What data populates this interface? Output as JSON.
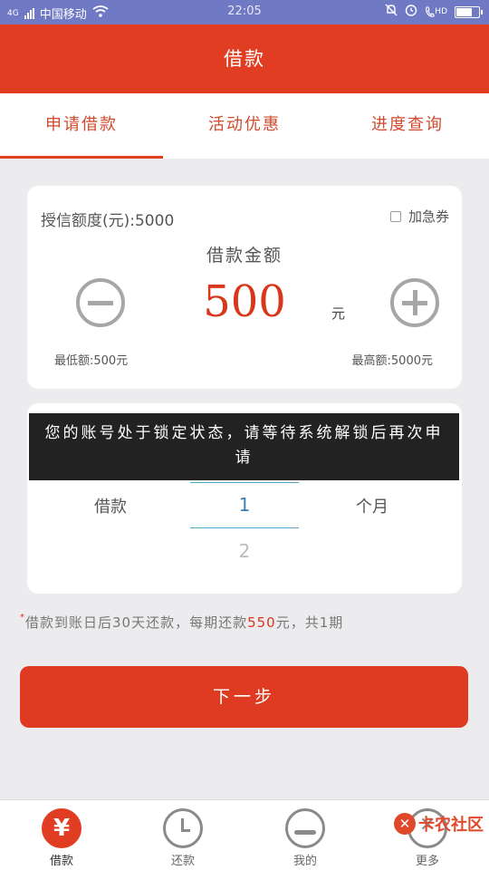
{
  "status_bar": {
    "network": "4G",
    "carrier": "中国移动",
    "time": "22:05",
    "hd": "HD",
    "battery_level": 0.7
  },
  "header": {
    "title": "借款"
  },
  "tabs": [
    {
      "label": "申请借款",
      "active": true
    },
    {
      "label": "活动优惠",
      "active": false
    },
    {
      "label": "进度查询",
      "active": false
    }
  ],
  "loan_card": {
    "credit_line": "授信额度(元):5000",
    "urgent_label": "加急券",
    "amount_title": "借款金额",
    "amount_value": "500",
    "unit": "元",
    "min_label": "最低额:500元",
    "max_label": "最高额:5000元"
  },
  "toast": {
    "message": "您的账号处于锁定状态，请等待系统解锁后再次申请"
  },
  "term_picker": {
    "label": "借款",
    "selected": "1",
    "next": "2",
    "unit": "个月"
  },
  "repay_note": {
    "star": "*",
    "prefix": "借款到账日后30天还款，每期还款",
    "amount": "550",
    "suffix": "元，共1期"
  },
  "next_button": {
    "label": "下一步"
  },
  "bottom_nav": [
    {
      "label": "借款",
      "icon": "yen-icon",
      "glyph": "¥",
      "active": true
    },
    {
      "label": "还款",
      "icon": "clock-icon",
      "active": false
    },
    {
      "label": "我的",
      "icon": "user-icon",
      "active": false
    },
    {
      "label": "更多",
      "icon": "more-icon",
      "active": false
    }
  ],
  "watermark": {
    "text": "卡农社区"
  },
  "colors": {
    "brand": "#e13d22",
    "status_bar": "#6f79c4",
    "amount": "#d8371c",
    "picker_accent": "#3d7fae"
  }
}
